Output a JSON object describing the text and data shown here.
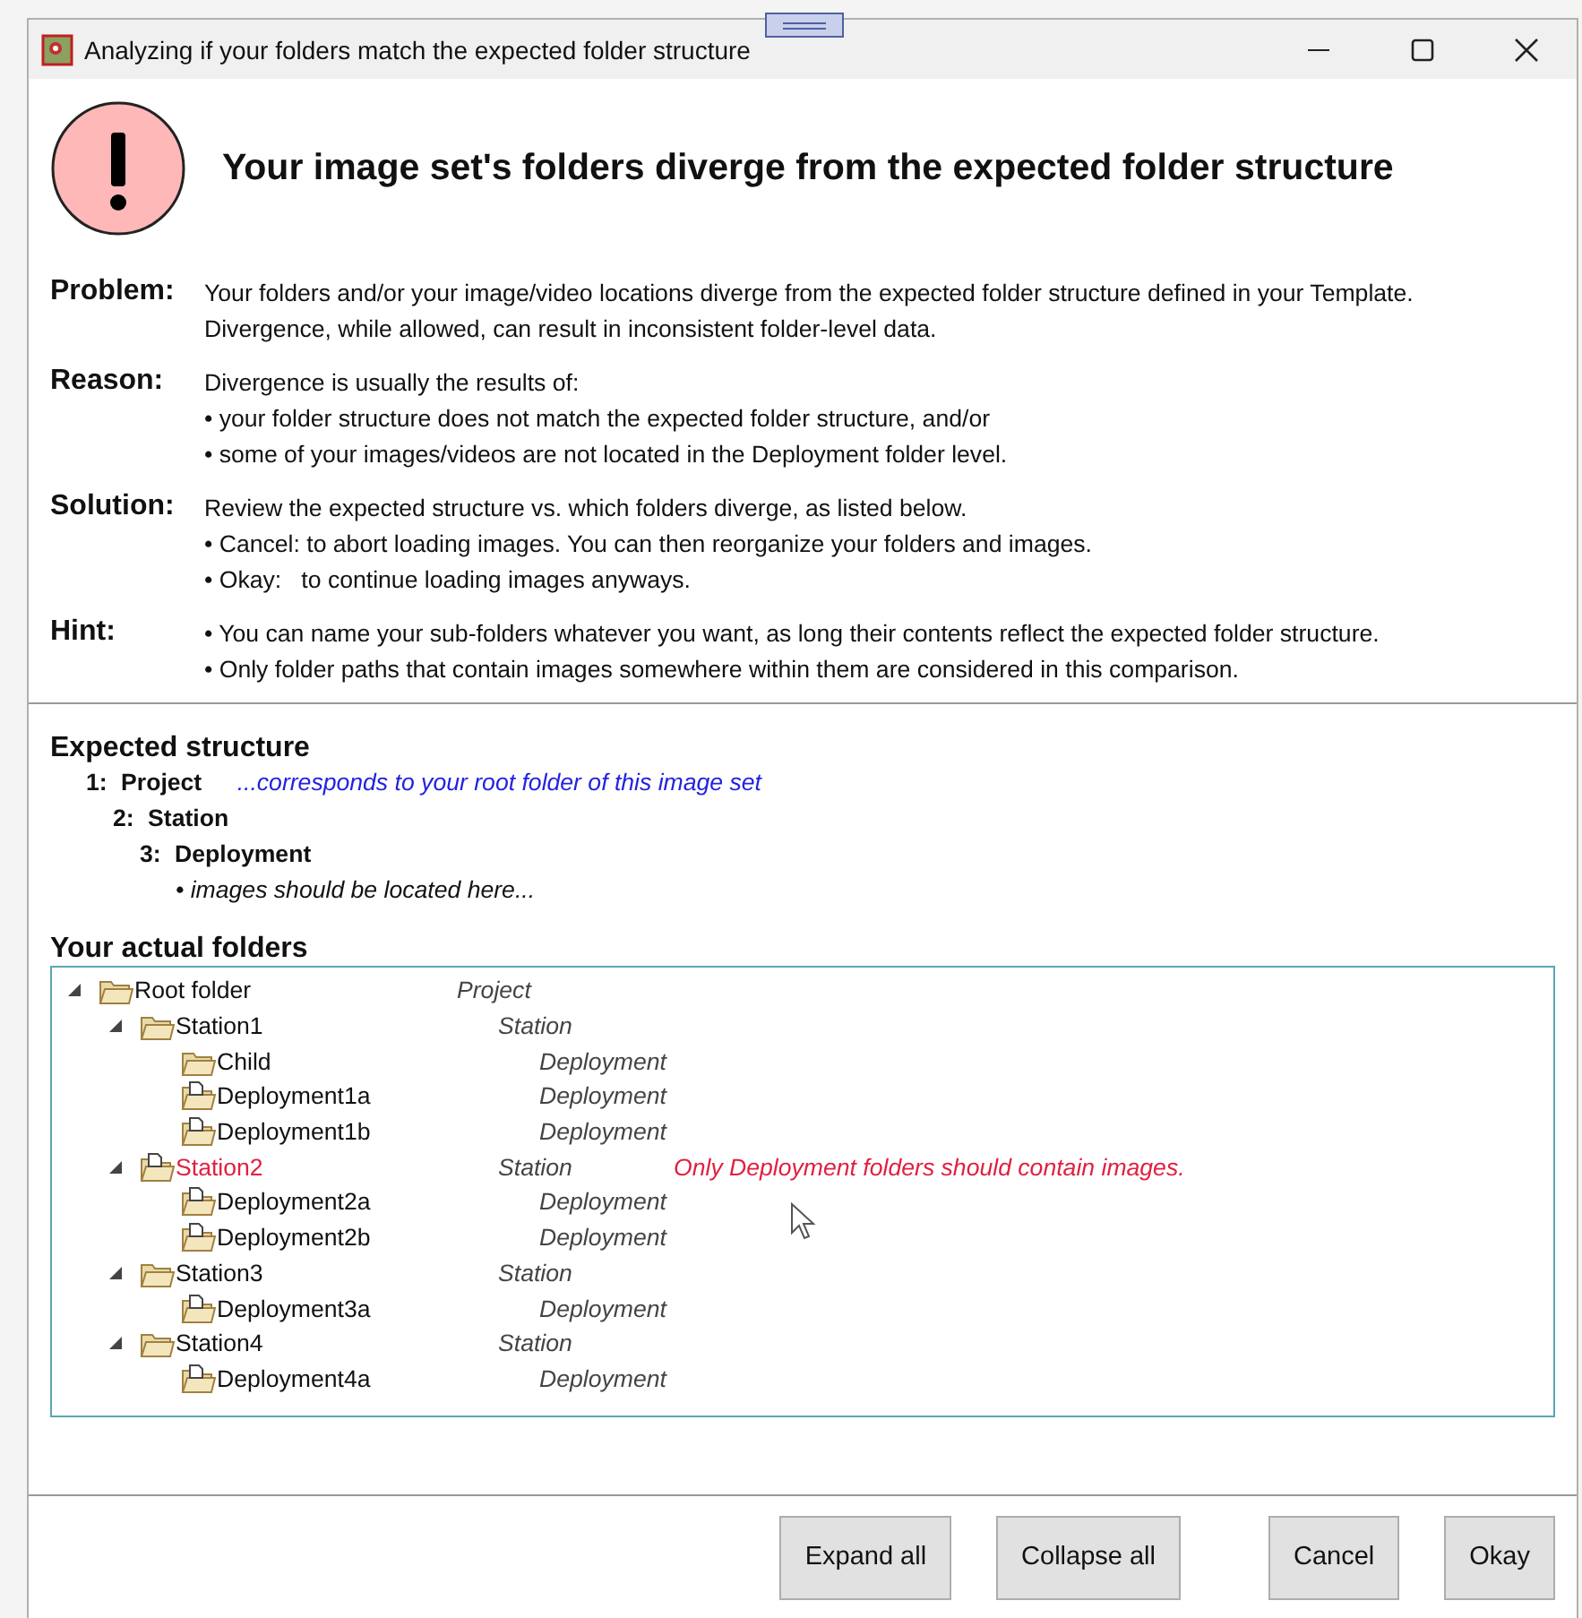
{
  "window": {
    "title": "Analyzing if your folders match the expected folder structure"
  },
  "header": {
    "title": "Your image set's folders diverge from the expected folder structure"
  },
  "sections": [
    {
      "label": "Problem:",
      "lines": [
        "Your folders and/or your image/video locations diverge from the expected folder structure defined in your Template.",
        "Divergence, while allowed, can result in inconsistent folder-level data."
      ]
    },
    {
      "label": "Reason:",
      "lines": [
        "Divergence is usually the results of:",
        "• your folder structure does not match the expected folder structure, and/or",
        "• some of your images/videos are not located in the Deployment folder level."
      ]
    },
    {
      "label": "Solution:",
      "lines": [
        "Review the expected structure vs. which folders diverge, as listed below.",
        "• Cancel: to abort loading images. You can then reorganize your folders and images.",
        "• Okay:   to continue loading images anyways."
      ]
    },
    {
      "label": "Hint:",
      "lines": [
        "• You can name your sub-folders whatever you want, as long their contents reflect the expected folder structure.",
        "• Only folder paths that contain images somewhere within them are considered in this comparison."
      ]
    }
  ],
  "expected": {
    "heading": "Expected structure",
    "levels": [
      {
        "number": "1:",
        "name": "Project",
        "note": "...corresponds to your root folder of this image set",
        "children": [
          {
            "number": "2:",
            "name": "Station",
            "children": [
              {
                "number": "3:",
                "name": "Deployment",
                "hint": "• images should be located here..."
              }
            ]
          }
        ]
      }
    ]
  },
  "actual": {
    "heading": "Your actual folders",
    "tree": [
      {
        "name": "Root folder",
        "type": "Project",
        "expanded": true,
        "contains_images": false,
        "error": false,
        "children": [
          {
            "name": "Station1",
            "type": "Station",
            "expanded": true,
            "contains_images": false,
            "error": false,
            "children": [
              {
                "name": "Child",
                "type": "Deployment",
                "contains_images": false,
                "error": false
              },
              {
                "name": "Deployment1a",
                "type": "Deployment",
                "contains_images": true,
                "error": false
              },
              {
                "name": "Deployment1b",
                "type": "Deployment",
                "contains_images": true,
                "error": false
              }
            ]
          },
          {
            "name": "Station2",
            "type": "Station",
            "expanded": true,
            "contains_images": true,
            "error": true,
            "message": "Only Deployment folders should contain images.",
            "children": [
              {
                "name": "Deployment2a",
                "type": "Deployment",
                "contains_images": true,
                "error": false
              },
              {
                "name": "Deployment2b",
                "type": "Deployment",
                "contains_images": true,
                "error": false
              }
            ]
          },
          {
            "name": "Station3",
            "type": "Station",
            "expanded": true,
            "contains_images": false,
            "error": false,
            "children": [
              {
                "name": "Deployment3a",
                "type": "Deployment",
                "contains_images": true,
                "error": false
              }
            ]
          },
          {
            "name": "Station4",
            "type": "Station",
            "expanded": true,
            "contains_images": false,
            "error": false,
            "children": [
              {
                "name": "Deployment4a",
                "type": "Deployment",
                "contains_images": true,
                "error": false
              }
            ]
          }
        ]
      }
    ]
  },
  "buttons": [
    {
      "label": "Expand all"
    },
    {
      "label": "Collapse all"
    },
    {
      "label": "Cancel"
    },
    {
      "label": "Okay"
    }
  ]
}
